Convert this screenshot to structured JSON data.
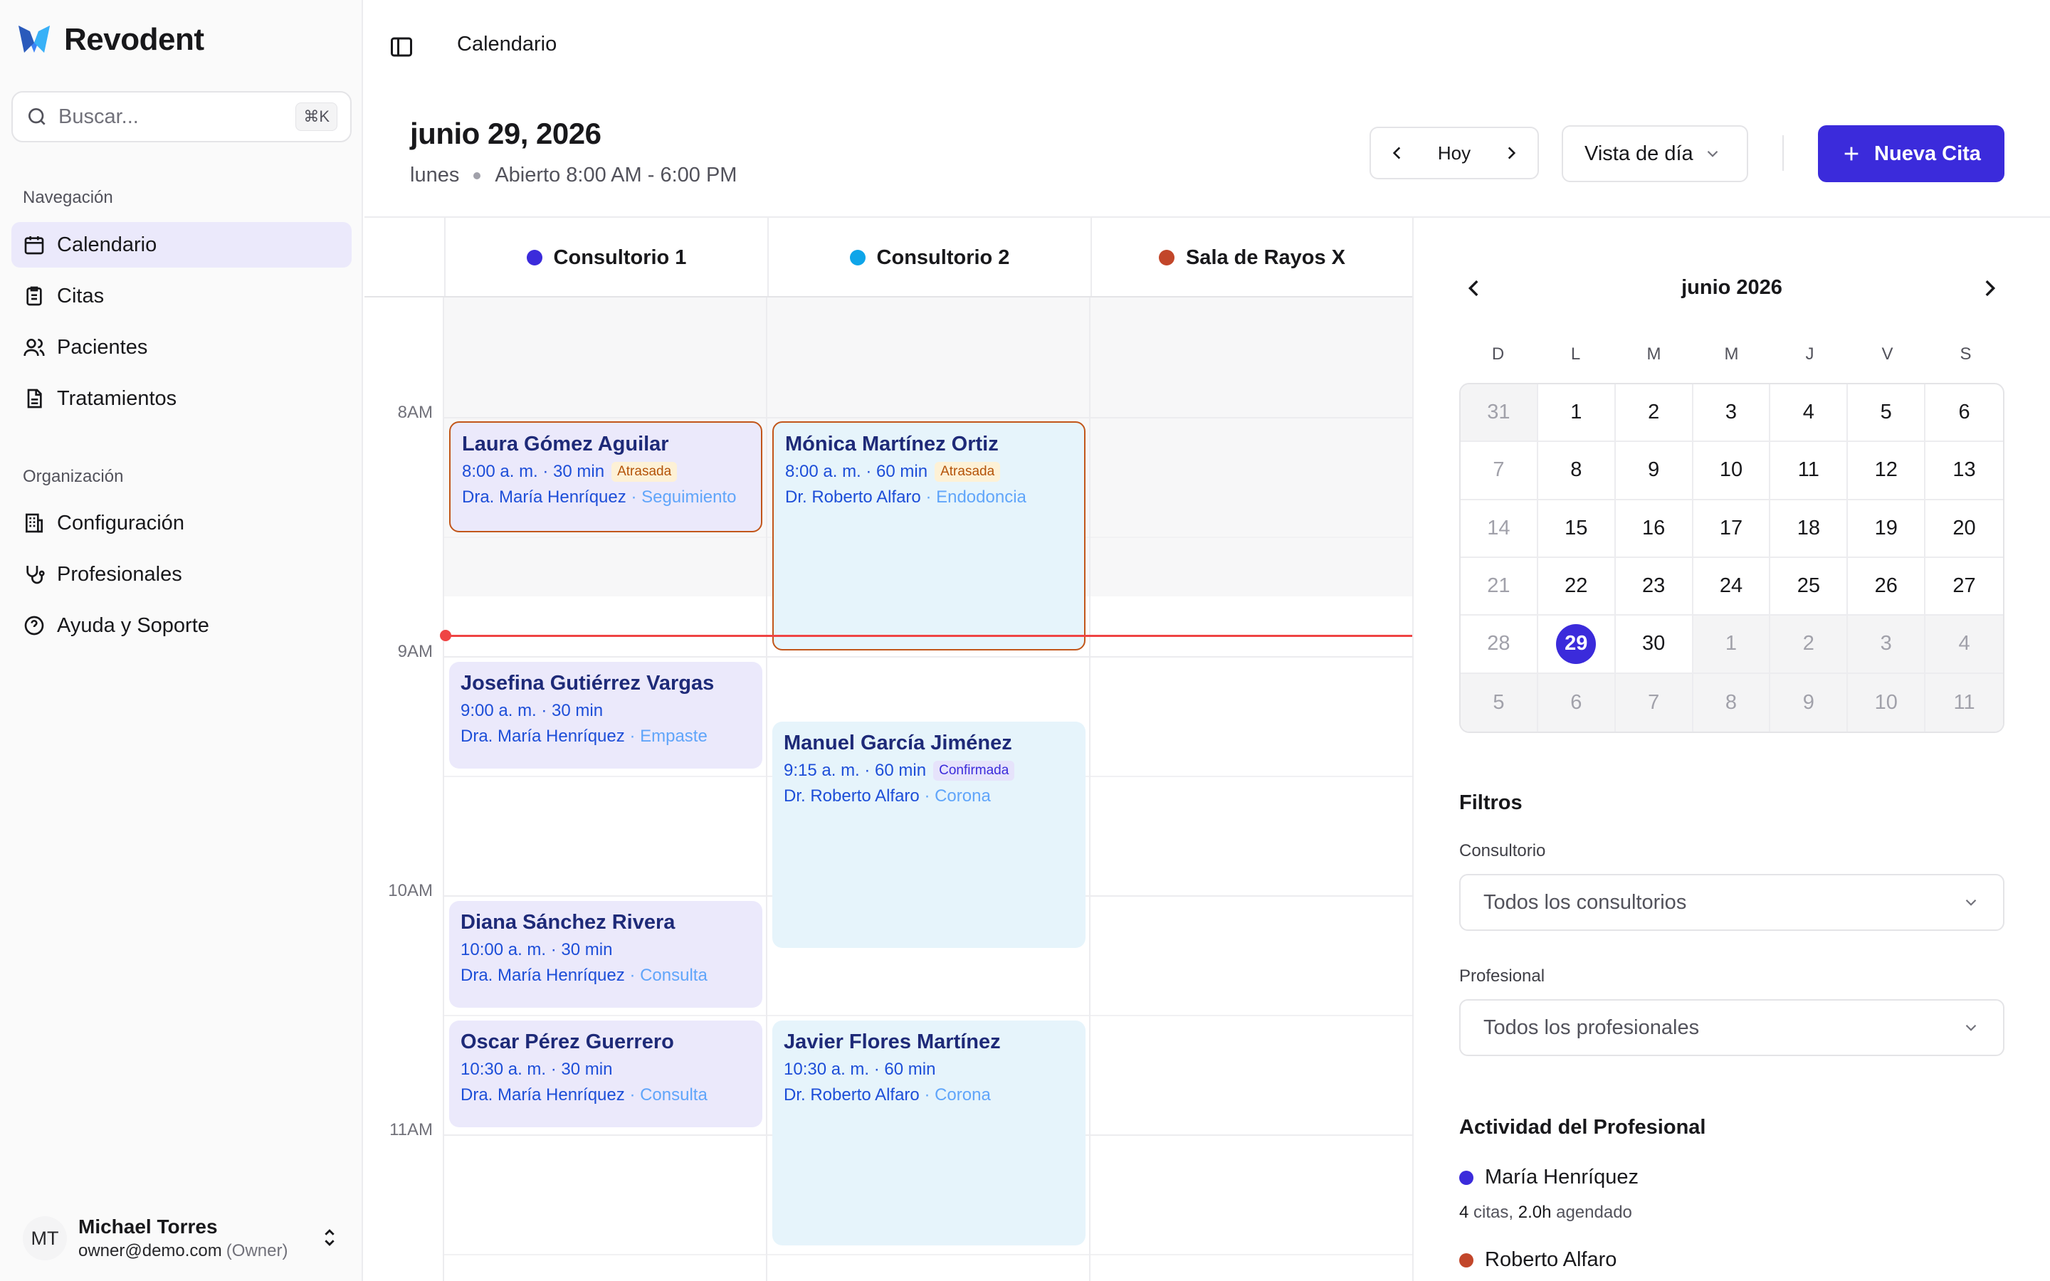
{
  "app": {
    "name": "Revodent"
  },
  "search": {
    "placeholder": "Buscar...",
    "shortcut": "⌘K"
  },
  "sidebar": {
    "nav_label": "Navegación",
    "nav_items": [
      {
        "label": "Calendario",
        "icon": "calendar-icon",
        "active": true
      },
      {
        "label": "Citas",
        "icon": "clipboard-icon"
      },
      {
        "label": "Pacientes",
        "icon": "users-icon"
      },
      {
        "label": "Tratamientos",
        "icon": "file-text-icon"
      }
    ],
    "org_label": "Organización",
    "org_items": [
      {
        "label": "Configuración",
        "icon": "building-icon"
      },
      {
        "label": "Profesionales",
        "icon": "stethoscope-icon"
      },
      {
        "label": "Ayuda y Soporte",
        "icon": "help-circle-icon"
      }
    ]
  },
  "user": {
    "initials": "MT",
    "name": "Michael Torres",
    "email": "owner@demo.com",
    "role": "(Owner)"
  },
  "topbar": {
    "breadcrumb": "Calendario"
  },
  "header": {
    "date": "junio 29, 2026",
    "weekday": "lunes",
    "hours": "Abierto 8:00 AM - 6:00 PM",
    "today_label": "Hoy",
    "view_label": "Vista de día",
    "new_label": "Nueva Cita"
  },
  "columns": [
    {
      "name": "Consultorio 1",
      "color": "#3b2bdb"
    },
    {
      "name": "Consultorio 2",
      "color": "#0ea5e9"
    },
    {
      "name": "Sala de Rayos X",
      "color": "#c2462a"
    }
  ],
  "time_labels": [
    "8AM",
    "9AM",
    "10AM",
    "11AM"
  ],
  "appointments": [
    {
      "name": "Laura Gómez Aguilar",
      "time": "8:00 a. m. · 30 min",
      "badge": "Atrasada",
      "doctor": "Dra. María Henríquez",
      "treatment": "· Seguimiento"
    },
    {
      "name": "Mónica Martínez Ortiz",
      "time": "8:00 a. m. · 60 min",
      "badge": "Atrasada",
      "doctor": "Dr. Roberto Alfaro",
      "treatment": "· Endodoncia"
    },
    {
      "name": "Josefina Gutiérrez Vargas",
      "time": "9:00 a. m. · 30 min",
      "doctor": "Dra. María Henríquez",
      "treatment": "· Empaste"
    },
    {
      "name": "Manuel García Jiménez",
      "time": "9:15 a. m. · 60 min",
      "badge": "Confirmada",
      "doctor": "Dr. Roberto Alfaro",
      "treatment": "· Corona"
    },
    {
      "name": "Diana Sánchez Rivera",
      "time": "10:00 a. m. · 30 min",
      "doctor": "Dra. María Henríquez",
      "treatment": "· Consulta"
    },
    {
      "name": "Oscar Pérez Guerrero",
      "time": "10:30 a. m. · 30 min",
      "doctor": "Dra. María Henríquez",
      "treatment": "· Consulta"
    },
    {
      "name": "Javier Flores Martínez",
      "time": "10:30 a. m. · 60 min",
      "doctor": "Dr. Roberto Alfaro",
      "treatment": "· Corona"
    }
  ],
  "mini_calendar": {
    "title": "junio 2026",
    "weekdays": [
      "D",
      "L",
      "M",
      "M",
      "J",
      "V",
      "S"
    ],
    "days": [
      "31",
      "1",
      "2",
      "3",
      "4",
      "5",
      "6",
      "7",
      "8",
      "9",
      "10",
      "11",
      "12",
      "13",
      "14",
      "15",
      "16",
      "17",
      "18",
      "19",
      "20",
      "21",
      "22",
      "23",
      "24",
      "25",
      "26",
      "27",
      "28",
      "29",
      "30",
      "1",
      "2",
      "3",
      "4",
      "5",
      "6",
      "7",
      "8",
      "9",
      "10",
      "11"
    ],
    "selected": "29"
  },
  "filters": {
    "title": "Filtros",
    "office_label": "Consultorio",
    "office_value": "Todos los consultorios",
    "professional_label": "Profesional",
    "professional_value": "Todos los profesionales"
  },
  "activity": {
    "title": "Actividad del Profesional",
    "items": [
      {
        "name": "María Henríquez",
        "color": "#3b2bdb",
        "count": "4",
        "count_label": "citas,",
        "hours": "2.0h",
        "hours_label": "agendado"
      },
      {
        "name": "Roberto Alfaro",
        "color": "#c2462a"
      }
    ]
  }
}
